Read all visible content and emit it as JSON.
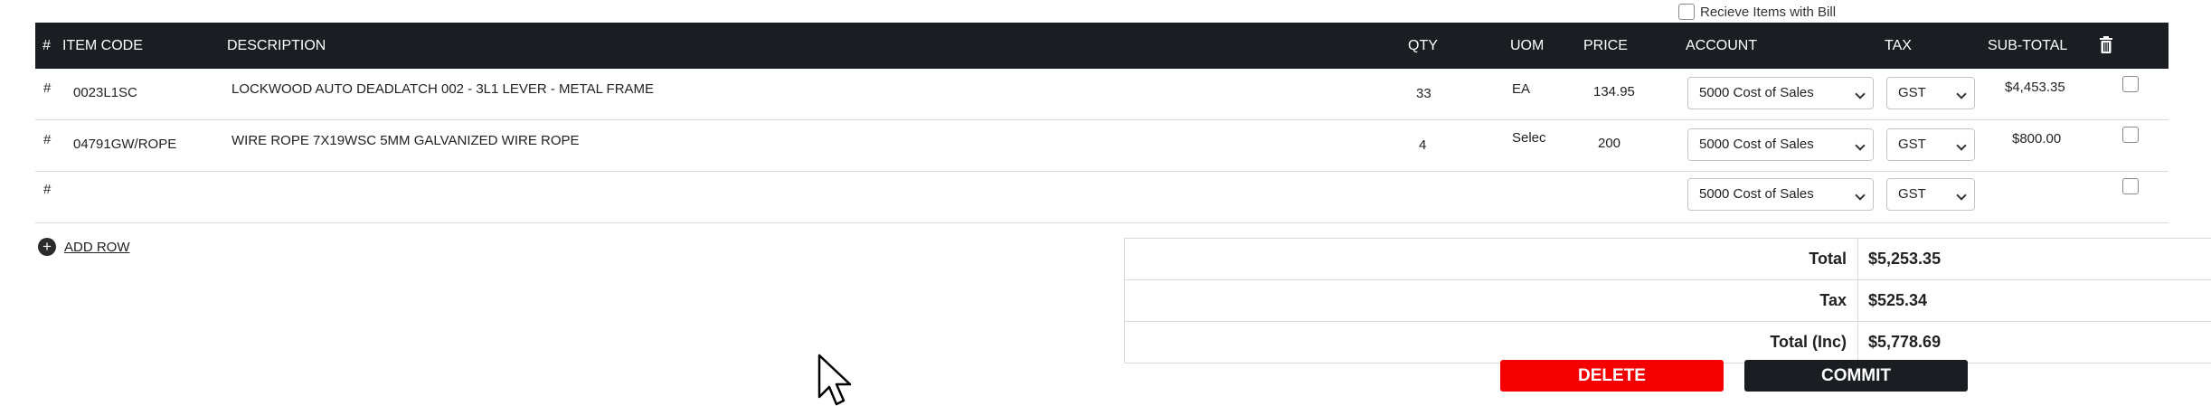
{
  "receive_with_bill_label": "Recieve Items with Bill",
  "columns": {
    "hash": "#",
    "item_code": "ITEM CODE",
    "description": "DESCRIPTION",
    "qty": "QTY",
    "uom": "UOM",
    "price": "PRICE",
    "account": "ACCOUNT",
    "tax": "TAX",
    "subtotal": "SUB-TOTAL",
    "delete_icon": "trash-icon"
  },
  "rows": [
    {
      "hash": "#",
      "item_code": "0023L1SC",
      "description": "LOCKWOOD AUTO DEADLATCH 002 - 3L1 LEVER - METAL FRAME",
      "qty": "33",
      "uom": "EA",
      "price": "134.95",
      "account": "5000 Cost of Sales",
      "tax": "GST",
      "subtotal": "$4,453.35"
    },
    {
      "hash": "#",
      "item_code": "04791GW/ROPE",
      "description": "WIRE ROPE 7X19WSC 5MM GALVANIZED WIRE ROPE",
      "qty": "4",
      "uom": "Selec",
      "price": "200",
      "account": "5000 Cost of Sales",
      "tax": "GST",
      "subtotal": "$800.00"
    },
    {
      "hash": "#",
      "item_code": "",
      "description": "",
      "qty": "",
      "uom": "",
      "price": "",
      "account": "5000 Cost of Sales",
      "tax": "GST",
      "subtotal": ""
    }
  ],
  "add_row_label": "ADD ROW",
  "totals": [
    {
      "label": "Total",
      "value": "$5,253.35"
    },
    {
      "label": "Tax",
      "value": "$525.34"
    },
    {
      "label": "Total (Inc)",
      "value": "$5,778.69"
    }
  ],
  "buttons": {
    "delete": "DELETE",
    "commit": "COMMIT"
  },
  "colors": {
    "header_bg": "#1a1e22",
    "delete_btn": "#f50000",
    "commit_btn": "#1a1e22"
  }
}
